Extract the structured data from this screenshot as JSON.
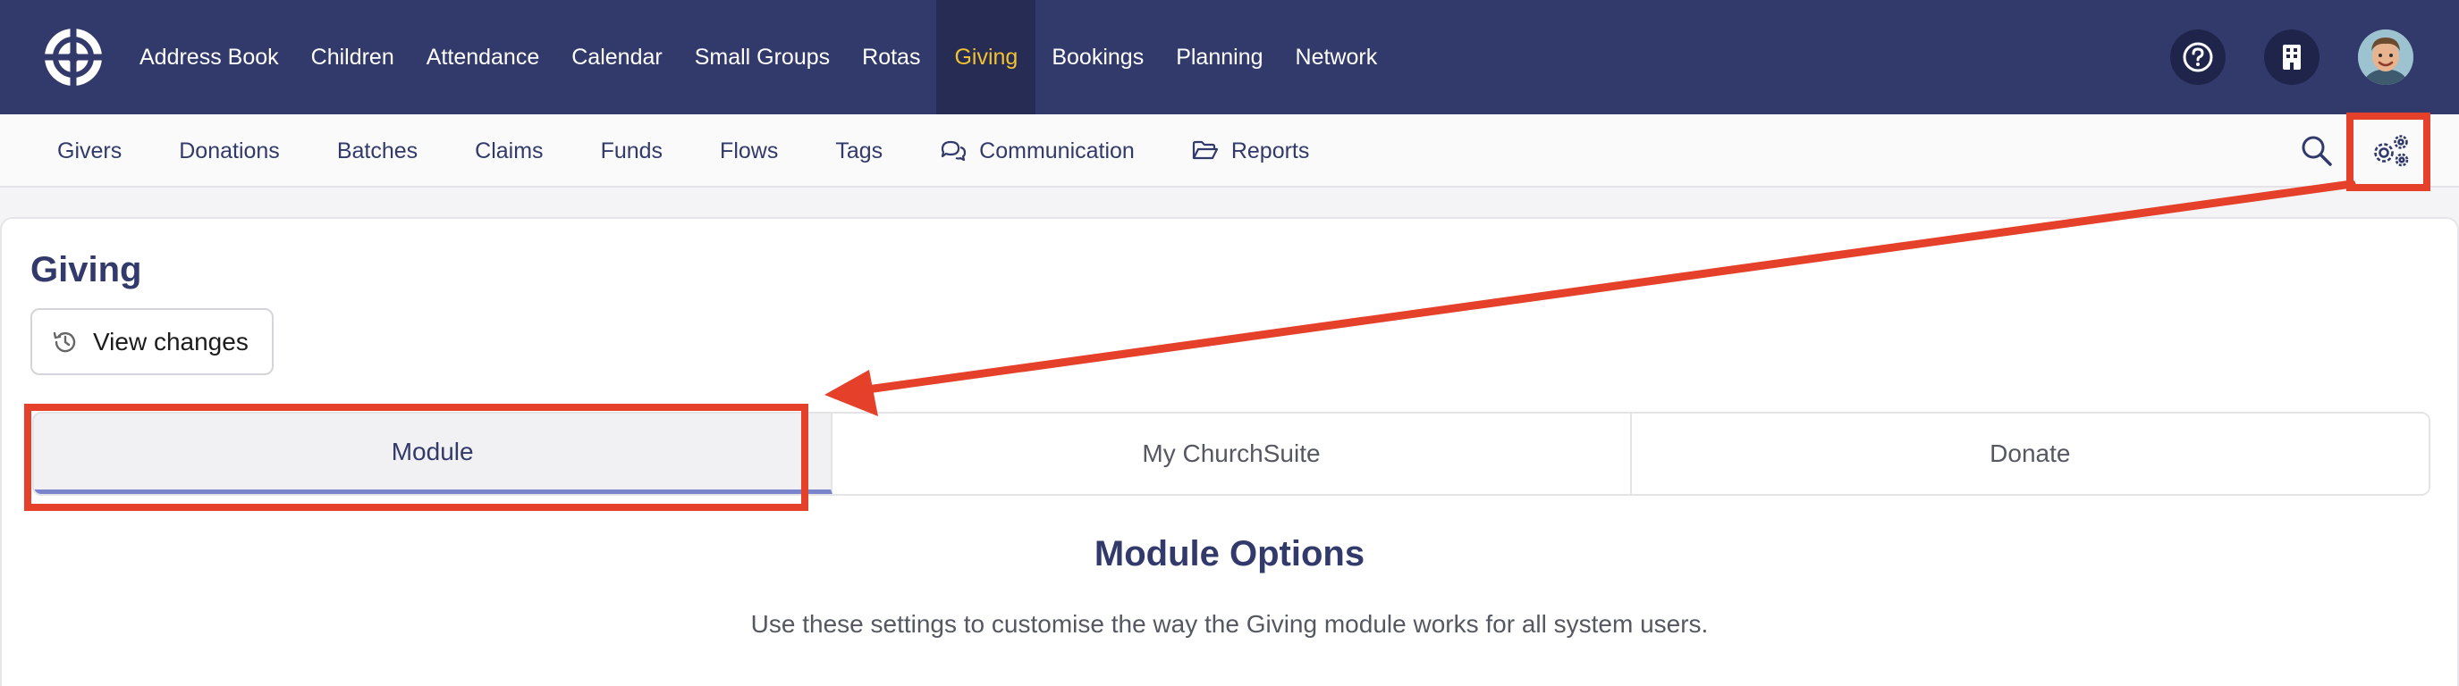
{
  "topnav": {
    "items": [
      {
        "label": "Address Book"
      },
      {
        "label": "Children"
      },
      {
        "label": "Attendance"
      },
      {
        "label": "Calendar"
      },
      {
        "label": "Small Groups"
      },
      {
        "label": "Rotas"
      },
      {
        "label": "Giving",
        "active": true
      },
      {
        "label": "Bookings"
      },
      {
        "label": "Planning"
      },
      {
        "label": "Network"
      }
    ],
    "accent_color": "#f2c230",
    "background_color": "#323a6b"
  },
  "subnav": {
    "items": [
      {
        "label": "Givers"
      },
      {
        "label": "Donations"
      },
      {
        "label": "Batches"
      },
      {
        "label": "Claims"
      },
      {
        "label": "Funds"
      },
      {
        "label": "Flows"
      },
      {
        "label": "Tags"
      },
      {
        "label": "Communication",
        "icon": "chat-bubbles-icon"
      },
      {
        "label": "Reports",
        "icon": "folder-open-icon"
      }
    ]
  },
  "page": {
    "title": "Giving",
    "view_changes_label": "View changes"
  },
  "tabs": [
    {
      "label": "Module",
      "active": true
    },
    {
      "label": "My ChurchSuite"
    },
    {
      "label": "Donate"
    }
  ],
  "section": {
    "heading": "Module Options",
    "description": "Use these settings to customise the way the Giving module works for all system users."
  },
  "annotation": {
    "color": "#e4402a"
  }
}
